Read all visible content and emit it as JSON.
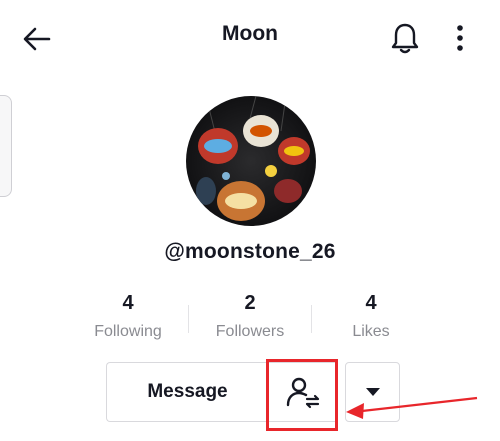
{
  "header": {
    "title": "Moon"
  },
  "profile": {
    "username": "@moonstone_26"
  },
  "stats": [
    {
      "value": "4",
      "label": "Following"
    },
    {
      "value": "2",
      "label": "Followers"
    },
    {
      "value": "4",
      "label": "Likes"
    }
  ],
  "actions": {
    "message_label": "Message"
  },
  "icons": {
    "back": "arrow-left-icon",
    "notifications": "bell-icon",
    "more": "vertical-dots-icon",
    "friend": "person-swap-icon",
    "dropdown": "caret-down-icon"
  },
  "colors": {
    "highlight": "#e8262b",
    "text": "#161823",
    "muted": "#8a8b91"
  }
}
